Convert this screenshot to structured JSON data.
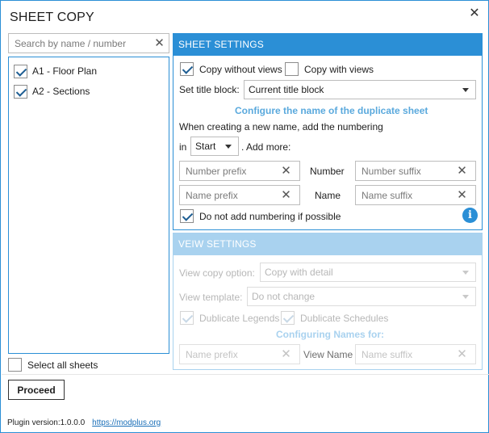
{
  "window": {
    "title": "SHEET COPY",
    "close_glyph": "✕"
  },
  "search": {
    "placeholder": "Search by name / number",
    "value": ""
  },
  "sheets": [
    {
      "label": "A1 - Floor Plan",
      "checked": true
    },
    {
      "label": "A2 - Sections",
      "checked": true
    }
  ],
  "select_all": {
    "label": "Select all sheets",
    "checked": false
  },
  "sheet_settings": {
    "header": "SHEET SETTINGS",
    "copy_without_views": {
      "label": "Copy without views",
      "checked": true
    },
    "copy_with_views": {
      "label": "Copy with views",
      "checked": false
    },
    "title_block_label": "Set title block:",
    "title_block_value": "Current title block",
    "configure_title": "Configure the name of the duplicate sheet",
    "numbering_text": "When creating a new name, add the numbering",
    "in_label": "in",
    "position_value": "Start",
    "add_more_label": ". Add more:",
    "number_prefix_placeholder": "Number prefix",
    "number_label": "Number",
    "number_suffix_placeholder": "Number suffix",
    "name_prefix_placeholder": "Name prefix",
    "name_label": "Name",
    "name_suffix_placeholder": "Name suffix",
    "no_numbering": {
      "label": "Do not add numbering if possible",
      "checked": true
    },
    "info_glyph": "i"
  },
  "view_settings": {
    "header": "VEIW SETTINGS",
    "copy_option_label": "View copy option:",
    "copy_option_value": "Copy with detail",
    "template_label": "View template:",
    "template_value": "Do not change",
    "dublicate_legends": {
      "label": "Dublicate Legends",
      "checked": true
    },
    "dublicate_schedules": {
      "label": "Dublicate Schedules",
      "checked": true
    },
    "configuring_title": "Configuring Names for:",
    "name_prefix_placeholder": "Name prefix",
    "view_name_label": "View Name",
    "name_suffix_placeholder": "Name suffix"
  },
  "actions": {
    "proceed_label": "Proceed"
  },
  "footer": {
    "version": "Plugin version:1.0.0.0",
    "link": "https://modplus.org"
  },
  "colors": {
    "accent": "#2b8fd6",
    "accent_disabled": "#a9d2ef",
    "section_title": "#5aa9dd"
  }
}
